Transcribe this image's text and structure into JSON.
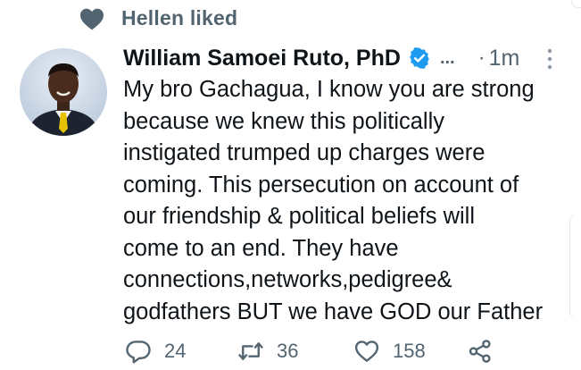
{
  "social_context": {
    "icon": "heart-icon",
    "text": "Hellen liked"
  },
  "tweet": {
    "author": "William Samoei Ruto, PhD",
    "verified_icon": "verified-badge-icon",
    "ellipsis": "...",
    "separator": "·",
    "time": "1m",
    "more_icon": "more-vertical-icon",
    "text_lines": [
      "My bro Gachagua, I know you are strong",
      "because we knew this politically",
      "instigated trumped up charges were",
      "coming. This persecution on account of",
      "our friendship & political beliefs will",
      "come to an end. They have",
      "connections,networks,pedigree&",
      "godfathers BUT we have GOD our Father"
    ]
  },
  "actions": {
    "reply": {
      "icon": "reply-icon",
      "count": "24"
    },
    "retweet": {
      "icon": "retweet-icon",
      "count": "36"
    },
    "like": {
      "icon": "like-icon",
      "count": "158"
    },
    "share": {
      "icon": "share-icon"
    }
  },
  "colors": {
    "secondary_text": "#536471",
    "primary_text": "#0f1419",
    "verified_blue": "#1d9bf0"
  }
}
